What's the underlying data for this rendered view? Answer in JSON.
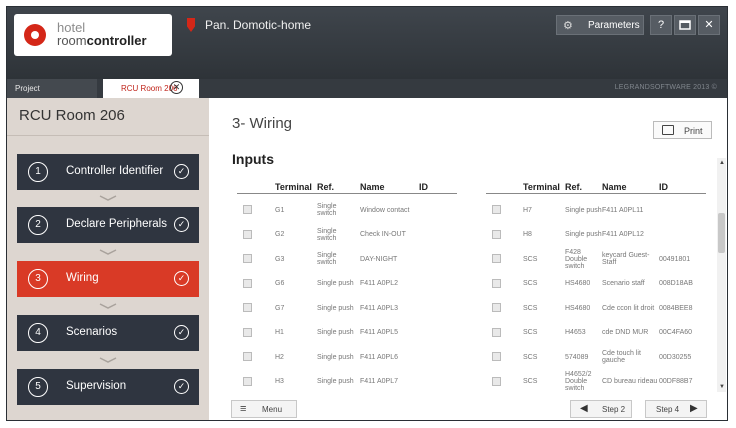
{
  "app": {
    "logo_hotel": "hotel",
    "logo_room": "room",
    "logo_controller": "controller",
    "title": "Pan. Domotic-home",
    "parameters_label": "Parameters",
    "help_label": "?",
    "maximize_icon": "maximize-icon",
    "close_label": "✕"
  },
  "tabs": {
    "project_label": "Project",
    "room_label": "RCU Room 206",
    "copyright": "LEGRANDSOFTWARE 2013 ©"
  },
  "sidebar": {
    "title": "RCU Room 206",
    "steps": [
      {
        "num": "1",
        "label": "Controller Identifier",
        "completed": true
      },
      {
        "num": "2",
        "label": "Declare Peripherals",
        "completed": true
      },
      {
        "num": "3",
        "label": "Wiring",
        "completed": true,
        "active": true
      },
      {
        "num": "4",
        "label": "Scenarios",
        "completed": true
      },
      {
        "num": "5",
        "label": "Supervision",
        "completed": true
      }
    ]
  },
  "main": {
    "section_title": "3- Wiring",
    "print_label": "Print",
    "inputs_title": "Inputs",
    "columns": {
      "terminal": "Terminal",
      "ref": "Ref.",
      "name": "Name",
      "id": "ID"
    },
    "left_rows": [
      {
        "terminal": "G1",
        "ref": "Single switch",
        "name": "Window contact",
        "id": ""
      },
      {
        "terminal": "G2",
        "ref": "Single switch",
        "name": "Check IN-OUT",
        "id": ""
      },
      {
        "terminal": "G3",
        "ref": "Single switch",
        "name": "DAY-NIGHT",
        "id": ""
      },
      {
        "terminal": "G6",
        "ref": "Single push",
        "name": "F411 A0PL2",
        "id": ""
      },
      {
        "terminal": "G7",
        "ref": "Single push",
        "name": "F411 A0PL3",
        "id": ""
      },
      {
        "terminal": "H1",
        "ref": "Single push",
        "name": "F411 A0PL5",
        "id": ""
      },
      {
        "terminal": "H2",
        "ref": "Single push",
        "name": "F411 A0PL6",
        "id": ""
      },
      {
        "terminal": "H3",
        "ref": "Single push",
        "name": "F411 A0PL7",
        "id": ""
      }
    ],
    "right_rows": [
      {
        "terminal": "H7",
        "ref": "Single push",
        "name": "F411 A0PL11",
        "id": ""
      },
      {
        "terminal": "H8",
        "ref": "Single push",
        "name": "F411 A0PL12",
        "id": ""
      },
      {
        "terminal": "SCS",
        "ref": "F428 Double switch",
        "name": "keycard Guest-Staff",
        "id": "00491801"
      },
      {
        "terminal": "SCS",
        "ref": "HS4680",
        "name": "Scenario staff",
        "id": "008D18AB"
      },
      {
        "terminal": "SCS",
        "ref": "HS4680",
        "name": "Cde ccon lit droit",
        "id": "0084BEE8"
      },
      {
        "terminal": "SCS",
        "ref": "H4653",
        "name": "cde DND MUR",
        "id": "00C4FA60"
      },
      {
        "terminal": "SCS",
        "ref": "574089",
        "name": "Cde touch lit gauche",
        "id": "00D30255"
      },
      {
        "terminal": "SCS",
        "ref": "H4652/2 Double switch",
        "name": "CD bureau rideau",
        "id": "00DF88B7"
      }
    ],
    "menu_label": "Menu",
    "prev_step_label": "Step 2",
    "next_step_label": "Step 4"
  },
  "colors": {
    "titlebar": "#2e3338",
    "accent_red": "#d93a26",
    "step_dark": "#2f3540",
    "sidebar_bg": "#ddd6d0"
  }
}
